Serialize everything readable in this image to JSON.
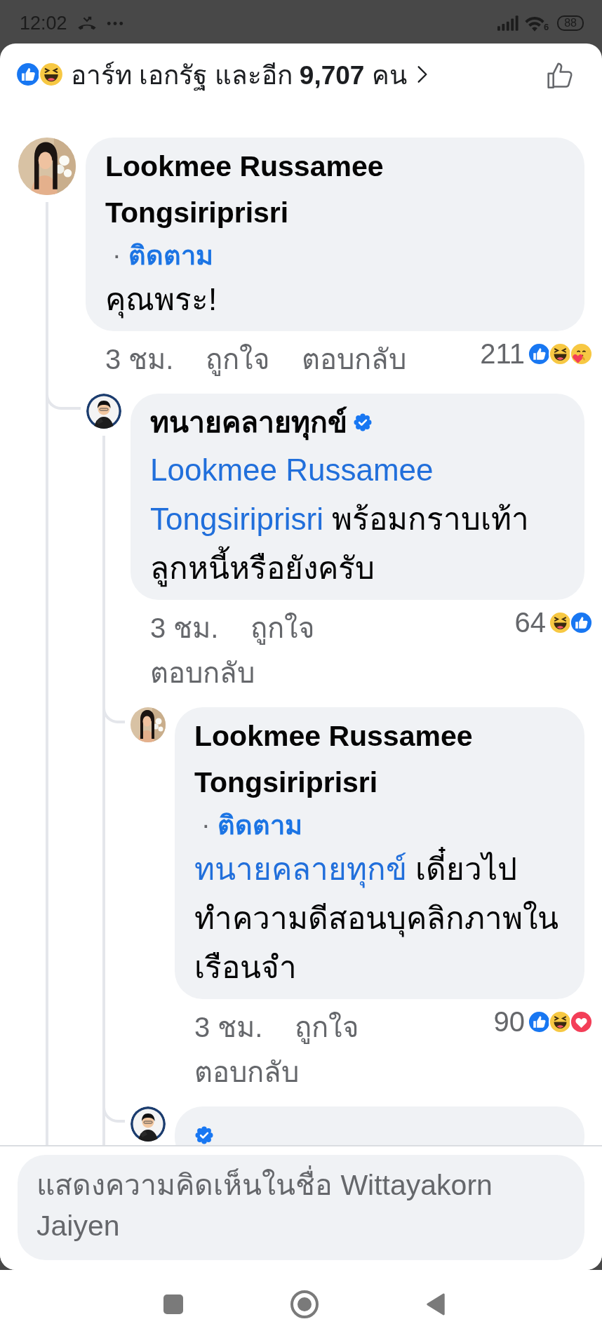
{
  "status_bar": {
    "time": "12:02",
    "wifi_label": "6",
    "battery": "88"
  },
  "header": {
    "reactions": [
      {
        "kind": "like"
      },
      {
        "kind": "haha"
      }
    ],
    "summary": "อาร์ท เอกรัฐ และอีก **9,707** คน"
  },
  "comments": [
    {
      "author": "Lookmee Russamee Tongsiriprisri",
      "verified": false,
      "follow": {
        "separator": "·",
        "label": "ติดตาม"
      },
      "body": [
        {
          "kind": "text",
          "text": "คุณพระ!"
        }
      ],
      "time": "3 ชม.",
      "actions": [
        "ถูกใจ",
        "ตอบกลับ"
      ],
      "reaction_count": "211",
      "reactions": [
        {
          "kind": "like"
        },
        {
          "kind": "haha"
        },
        {
          "kind": "care"
        }
      ],
      "children": [
        {
          "author": "ทนายคลายทุกข์",
          "verified": true,
          "body": [
            {
              "kind": "mention",
              "text": "Lookmee Russamee Tongsiriprisri"
            },
            {
              "kind": "text",
              "text": " พร้อมกราบเท้าลูกหนี้หรือยังครับ"
            }
          ],
          "time": "3 ชม.",
          "actions": [
            "ถูกใจ",
            "ตอบกลับ"
          ],
          "reaction_count": "64",
          "reactions": [
            {
              "kind": "haha"
            },
            {
              "kind": "like"
            }
          ],
          "children": [
            {
              "author": "Lookmee Russamee Tongsiriprisri",
              "verified": false,
              "follow": {
                "separator": "·",
                "label": "ติดตาม"
              },
              "body": [
                {
                  "kind": "mention",
                  "text": "ทนายคลายทุกข์"
                },
                {
                  "kind": "text",
                  "text": " เดี๋ยวไปทำความดีสอนบุคลิกภาพในเรือนจำ"
                }
              ],
              "time": "3 ชม.",
              "actions": [
                "ถูกใจ",
                "ตอบกลับ"
              ],
              "reaction_count": "90",
              "reactions": [
                {
                  "kind": "like"
                },
                {
                  "kind": "haha"
                },
                {
                  "kind": "love"
                }
              ]
            },
            {
              "verified": true
            }
          ]
        }
      ]
    }
  ],
  "composer": {
    "placeholder": "แสดงความคิดเห็นในชื่อ Wittayakorn Jaiyen"
  },
  "nav_bar": {
    "buttons": [
      {
        "kind": "recents"
      },
      {
        "kind": "home"
      },
      {
        "kind": "back"
      }
    ]
  }
}
